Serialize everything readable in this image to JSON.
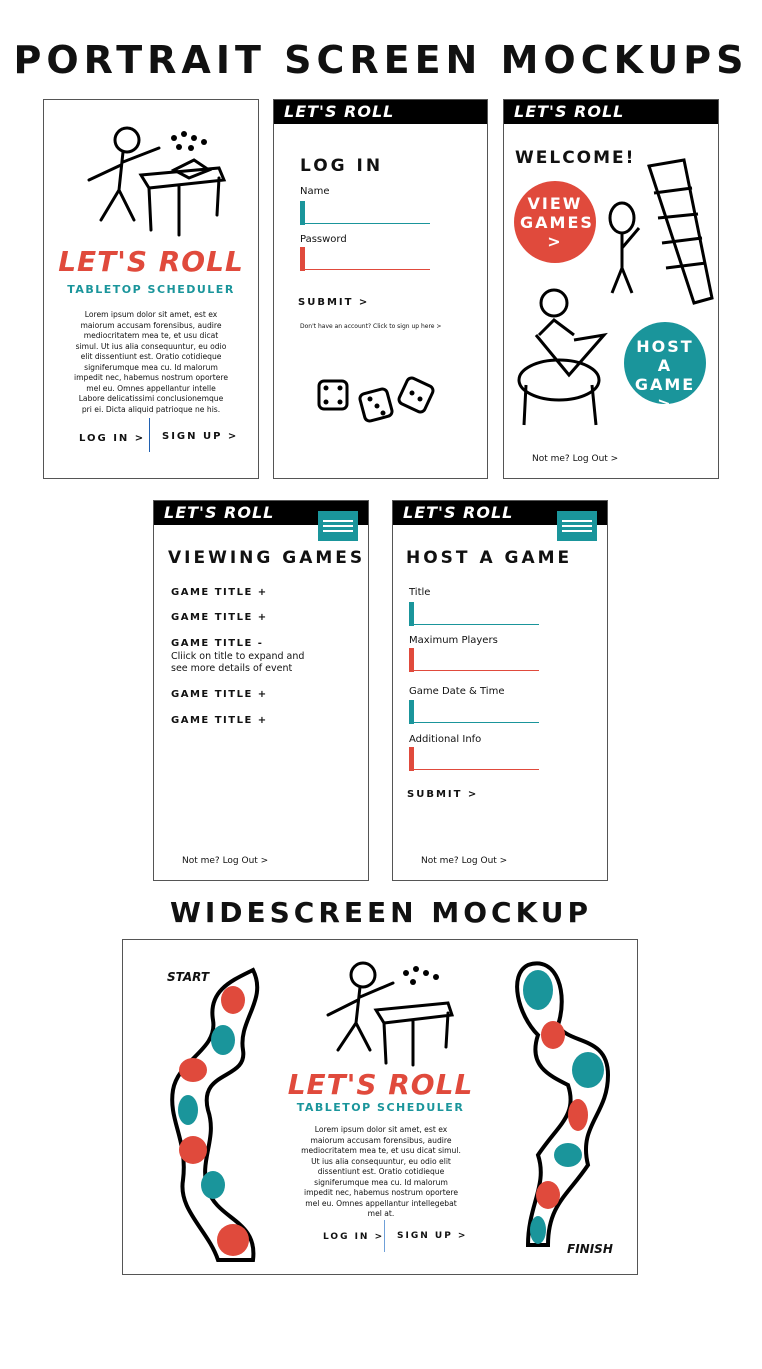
{
  "titles": {
    "portrait": "PORTRAIT SCREEN MOCKUPS",
    "wide": "WIDESCREEN MOCKUP"
  },
  "colors": {
    "red": "#e04a3c",
    "teal": "#1a959b"
  },
  "app": {
    "brand": "LET'S ROLL",
    "subtitle": "TABLETOP SCHEDULER"
  },
  "landing": {
    "lorem": "Lorem ipsum dolor sit amet, est ex maiorum accusam forensibus, audire mediocritatem mea te, et usu dicat simul. Ut ius alia consequuntur, eu odio elit dissentiunt est. Oratio cotidieque signiferumque mea cu. Id malorum impedit nec, habemus nostrum oportere mel eu. Omnes appellantur intelle Labore delicatissimi conclusionemque pri ei. Dicta aliquid patrioque ne his.",
    "login": "LOG IN >",
    "signup": "SIGN UP >"
  },
  "login": {
    "heading": "LOG IN",
    "name_label": "Name",
    "password_label": "Password",
    "submit": "SUBMIT >",
    "signup_link": "Don't have an account? Click to sign up here >"
  },
  "welcome": {
    "heading": "WELCOME!",
    "view": "VIEW GAMES",
    "host": "HOST A GAME",
    "arrow": ">",
    "logout": "Not me? Log Out >"
  },
  "viewing": {
    "heading": "VIEWING GAMES",
    "games": [
      "GAME TITLE +",
      "GAME TITLE +",
      "GAME TITLE -",
      "GAME TITLE +",
      "GAME TITLE +"
    ],
    "expanded_detail": "Cliick on title to expand and see more details of event",
    "logout": "Not me? Log Out >"
  },
  "host": {
    "heading": "HOST A GAME",
    "fields": [
      "Title",
      "Maximum Players",
      "Game Date & Time",
      "Additional Info"
    ],
    "submit": "SUBMIT >",
    "logout": "Not me? Log Out >"
  },
  "widescreen": {
    "start": "START",
    "finish": "FINISH",
    "lorem": "Lorem ipsum dolor sit amet, est ex maiorum accusam forensibus, audire mediocritatem mea te, et usu dicat simul. Ut ius alia consequuntur, eu odio elit dissentiunt est. Oratio cotidieque signiferumque mea cu. Id malorum impedit nec, habemus nostrum oportere mel eu. Omnes appellantur intellegebat mel at.",
    "login": "LOG IN >",
    "signup": "SIGN UP >"
  }
}
